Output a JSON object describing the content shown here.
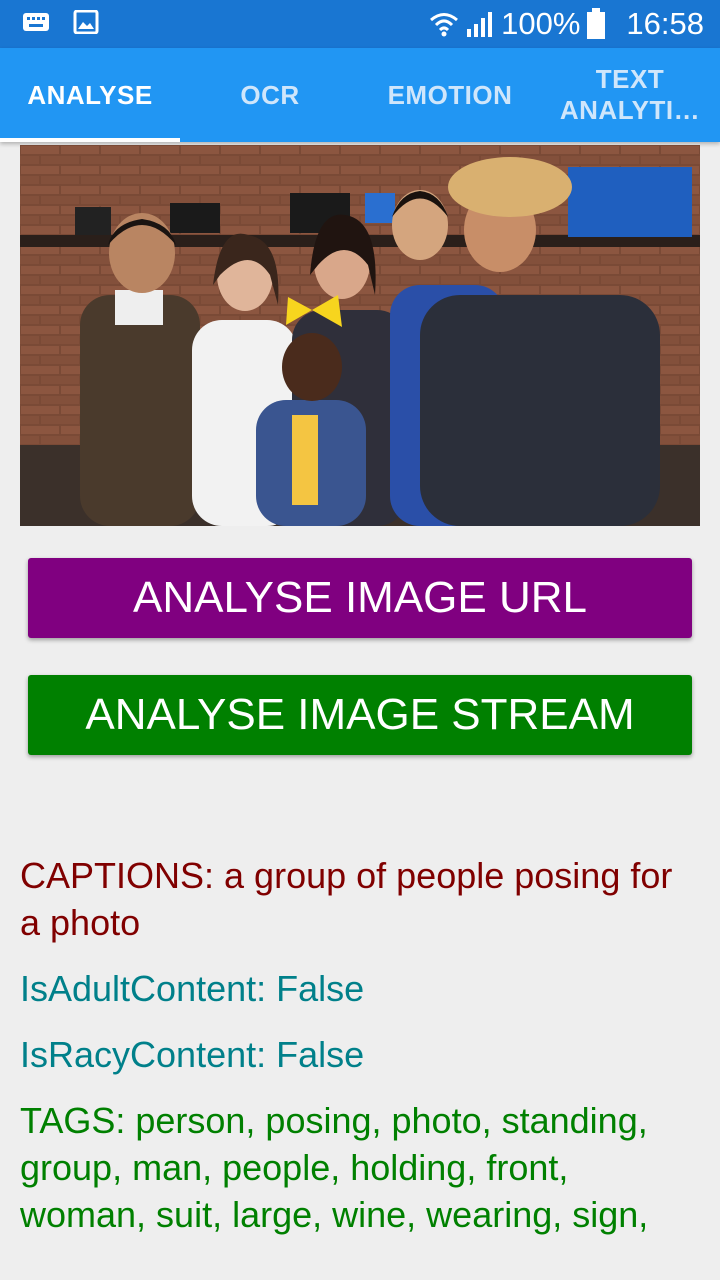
{
  "status_bar": {
    "left_icons": [
      "keyboard-icon",
      "image-icon"
    ],
    "right_icons": [
      "wifi-icon",
      "signal-icon",
      "battery-icon"
    ],
    "battery": "100%",
    "time": "16:58"
  },
  "tabs": [
    {
      "label": "ANALYSE",
      "active": true
    },
    {
      "label": "OCR",
      "active": false
    },
    {
      "label": "EMOTION",
      "active": false
    },
    {
      "label": "TEXT\nANALYTI…",
      "active": false
    }
  ],
  "buttons": {
    "analyse_url": "ANALYSE IMAGE URL",
    "analyse_stream": "ANALYSE IMAGE STREAM"
  },
  "results": {
    "captions": "CAPTIONS: a group of people posing for a photo",
    "is_adult": "IsAdultContent: False",
    "is_racy": "IsRacyContent: False",
    "tags": "TAGS: person, posing, photo, standing, group, man, people, holding, front, woman, suit, large, wine, wearing, sign,"
  },
  "colors": {
    "status_bar": "#1976d2",
    "tab_bar": "#2196f3",
    "button_url": "#800080",
    "button_stream": "#008000",
    "caption_text": "#800000",
    "flag_text": "#00808a",
    "tags_text": "#008000",
    "background": "#eeeeee"
  }
}
